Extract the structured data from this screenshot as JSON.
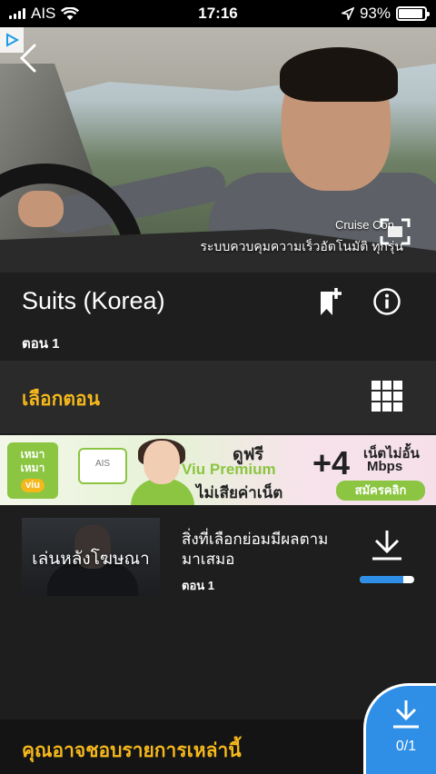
{
  "status_bar": {
    "carrier": "AIS",
    "time": "17:16",
    "battery_percent": "93%",
    "battery_level": 0.93
  },
  "video": {
    "subtitle_top": "Cruise Con",
    "subtitle_bottom": "ระบบควบคุมความเร็วอัตโนมัติ ทุกรุ่น"
  },
  "show": {
    "title": "Suits (Korea)",
    "episode_label": "ตอน 1"
  },
  "episode_selector": {
    "label": "เลือกตอน"
  },
  "banner": {
    "logo_text_1": "เหมา",
    "logo_text_2": "เหมา",
    "logo_brand": "viu",
    "phone_text": "AIS",
    "line1": "ดูฟรี",
    "line2": "Viu Premium",
    "line3": "ไม่เสียค่าเน็ต",
    "plus": "+4",
    "speed1": "เน็ตไม่อั้น",
    "speed2": "Mbps",
    "cta": "สมัครคลิก"
  },
  "episode_item": {
    "thumb_label": "เล่นหลังโฆษณา",
    "title_line1": "สิ่งที่เลือกย่อมมีผลตาม",
    "title_line2": "มาเสมอ",
    "episode": "ตอน 1",
    "download_progress": 0.8
  },
  "bottom": {
    "label": "คุณอาจชอบรายการเหล่านี้",
    "download_count": "0/1"
  },
  "colors": {
    "accent": "#f5b81c",
    "blue": "#2f8fe6",
    "background": "#1e1e1e"
  }
}
